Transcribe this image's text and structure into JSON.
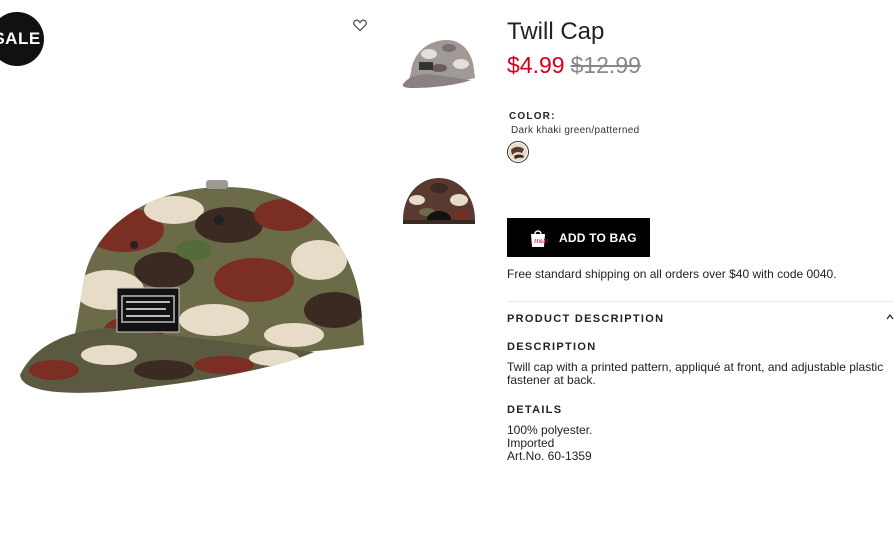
{
  "badge": {
    "label": "SALE"
  },
  "product": {
    "title": "Twill Cap",
    "price_current": "$4.99",
    "price_original": "$12.99"
  },
  "color": {
    "label": "COLOR:",
    "value": "Dark khaki green/patterned"
  },
  "actions": {
    "add_to_bag": "ADD TO BAG"
  },
  "shipping": {
    "note": "Free standard shipping on all orders over $40 with code 0040."
  },
  "product_description": {
    "heading": "PRODUCT DESCRIPTION",
    "description_heading": "DESCRIPTION",
    "description_text": "Twill cap with a printed pattern, appliqué at front, and adjustable plastic fastener at back.",
    "details_heading": "DETAILS",
    "details": [
      "100% polyester.",
      "Imported",
      "Art.No. 60-1359"
    ]
  },
  "icons": {
    "favorite": "heart-outline-icon",
    "bag": "shopping-bag-icon",
    "collapse": "chevron-up-icon"
  },
  "colors": {
    "sale_price": "#d6001c",
    "button_bg": "#000000",
    "badge_bg": "#111111"
  }
}
